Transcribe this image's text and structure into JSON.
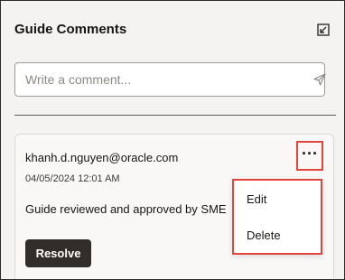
{
  "panel": {
    "title": "Guide Comments"
  },
  "icons": {
    "popout": "popout-icon",
    "send": "send-icon",
    "more": "more-horizontal-icon"
  },
  "input": {
    "placeholder": "Write a comment...",
    "value": ""
  },
  "comment": {
    "author": "khanh.d.nguyen@oracle.com",
    "timestamp": "04/05/2024 12:01 AM",
    "text": "Guide reviewed and approved by SME",
    "resolve_label": "Resolve",
    "more_label": "···"
  },
  "menu": {
    "items": [
      {
        "label": "Edit"
      },
      {
        "label": "Delete"
      }
    ]
  },
  "colors": {
    "highlight": "#e0453e",
    "button_dark": "#312d2a",
    "panel_bg": "#f4f3f1"
  }
}
